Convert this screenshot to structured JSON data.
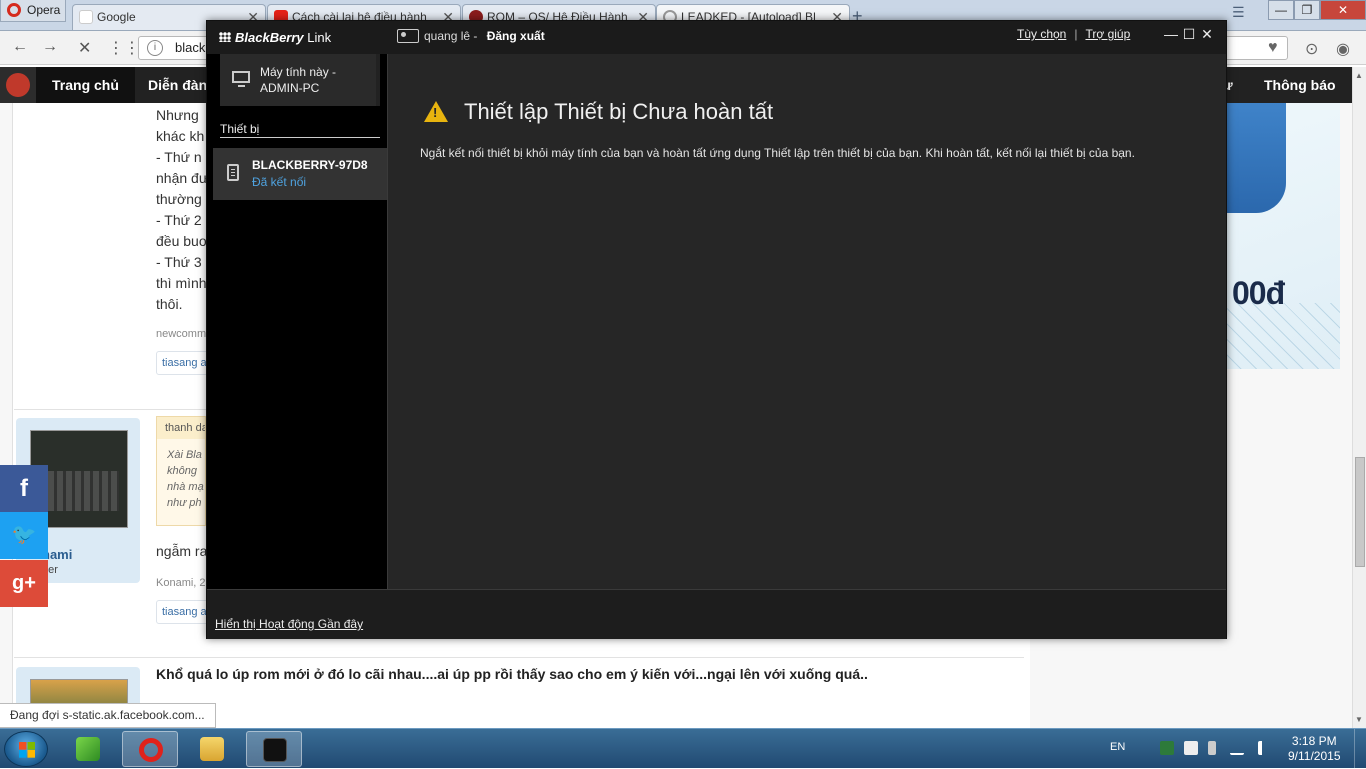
{
  "browser": {
    "menu_label": "Opera",
    "tabs": [
      {
        "label": "Google"
      },
      {
        "label": "Cách cài lại hệ điều hành"
      },
      {
        "label": "ROM – OS/ Hệ Điều Hành"
      },
      {
        "label": "LEADKED - [Autoload] Bl"
      }
    ],
    "url": "black"
  },
  "site": {
    "nav": {
      "home": "Trang chủ",
      "forum": "Diễn đàn",
      "partial": "hư",
      "notifications": "Thông báo"
    },
    "post1": {
      "lines": "Nhưng\nkhác kh\n- Thứ n\nnhận đư\nthường\n- Thứ 2\nđều buo\n- Thứ 3\nthì mình\nthôi.",
      "meta": "newcomm",
      "tag": "tiasang a"
    },
    "post2": {
      "quote_header": "thanh da",
      "quote_text": "Xài Bla\nkhông\nnhà mạ\nnhư ph",
      "username": "nami",
      "user_title": "ber",
      "reply": "ngẫm ra",
      "meta": "Konami, 2",
      "tag": "tiasang a"
    },
    "post3": {
      "text": "Khổ quá lo úp rom mới ở đó lo cãi nhau....ai úp pp rồi thấy sao cho em ý kiến với...ngại lên với xuống quá.."
    },
    "ad": {
      "price": "00đ"
    },
    "status": "Đang đợi s-static.ak.facebook.com..."
  },
  "bb_link": {
    "app_name_brand": "BlackBerry",
    "app_name_suffix": "Link",
    "user": "quang lê",
    "logout": "Đăng xuất",
    "options": "Tùy chọn",
    "help": "Trợ giúp",
    "computer_line1": "Máy tính này -",
    "computer_line2": "ADMIN-PC",
    "devices_header": "Thiết bị",
    "device_name": "BLACKBERRY-97D8",
    "device_status": "Đã kết nối",
    "main_title": "Thiết lập Thiết bị Chưa hoàn tất",
    "main_desc": "Ngắt kết nối thiết bị khỏi máy tính của bạn và hoàn tất ứng dụng Thiết lập trên thiết bị của bạn. Khi hoàn tất, kết nối lại thiết bị của bạn.",
    "footer_link": "Hiển thị Hoạt động Gần đây"
  },
  "taskbar": {
    "language": "EN",
    "time": "3:18 PM",
    "date": "9/11/2015"
  },
  "colors": {
    "bb_background": "#262626",
    "bb_sidebar": "#000000",
    "bb_connected": "#4fa3e0",
    "warning": "#e8b40f"
  }
}
